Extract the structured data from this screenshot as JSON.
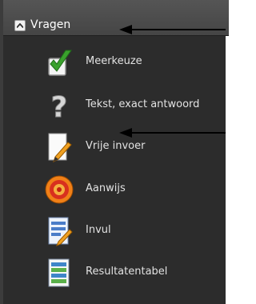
{
  "section": {
    "title": "Vragen",
    "items": [
      {
        "label": "Meerkeuze",
        "icon": "checkbox-check-icon"
      },
      {
        "label": "Tekst, exact antwoord",
        "icon": "question-mark-icon"
      },
      {
        "label": "Vrije invoer",
        "icon": "pencil-paper-icon"
      },
      {
        "label": "Aanwijs",
        "icon": "target-icon"
      },
      {
        "label": "Invul",
        "icon": "fill-in-form-icon"
      },
      {
        "label": "Resultatentabel",
        "icon": "results-table-icon"
      }
    ]
  },
  "colors": {
    "panel_bg": "#2c2c2c",
    "header_bg": "#4d4d4d",
    "text": "#e2e2e2"
  }
}
